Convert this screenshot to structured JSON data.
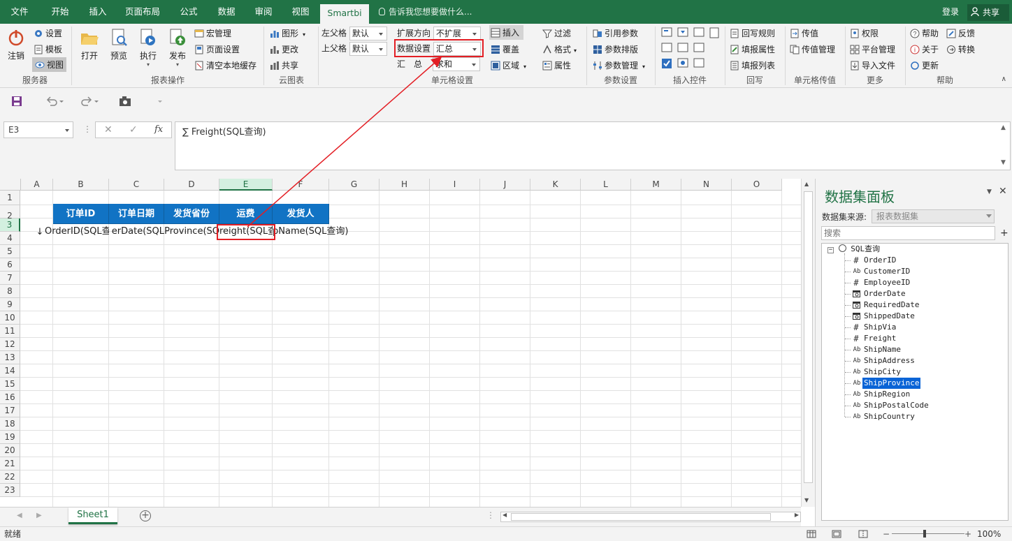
{
  "tabs": [
    "文件",
    "开始",
    "插入",
    "页面布局",
    "公式",
    "数据",
    "审阅",
    "视图",
    "Smartbi"
  ],
  "tell_me": "告诉我您想要做什么...",
  "login": "登录",
  "share": "共享",
  "ribbon": {
    "server": {
      "label": "服务器",
      "logout": "注销",
      "settings": "设置",
      "template": "模板",
      "view": "视图"
    },
    "report_ops": {
      "label": "报表操作",
      "open": "打开",
      "preview": "预览",
      "execute": "执行",
      "publish": "发布",
      "macro": "宏管理",
      "page_setup": "页面设置",
      "clear_cache": "清空本地缓存"
    },
    "cloud_chart": {
      "label": "云图表",
      "chart": "图形",
      "change": "更改",
      "share": "共享"
    },
    "cell_settings": {
      "label": "单元格设置",
      "left_parent": "左父格",
      "top_parent": "上父格",
      "left_parent_value": "默认",
      "top_parent_value": "默认",
      "expand_dir": "扩展方向",
      "expand_value": "不扩展",
      "data_setting": "数据设置",
      "data_value": "汇总",
      "summary": "汇　总",
      "summary_value": "求和",
      "insert": "插入",
      "cover": "覆盖",
      "region": "区域",
      "filter": "过滤",
      "format": "格式",
      "property": "属性"
    },
    "param_settings": {
      "label": "参数设置",
      "ref_param": "引用参数",
      "param_layout": "参数排版",
      "param_manage": "参数管理"
    },
    "insert_controls": {
      "label": "插入控件"
    },
    "writeback": {
      "label": "回写",
      "rules": "回写规则",
      "fill_props": "填报属性",
      "fill_list": "填报列表"
    },
    "cell_pass": {
      "label": "单元格传值",
      "pass": "传值",
      "pass_manage": "传值管理"
    },
    "more": {
      "label": "更多",
      "permission": "权限",
      "platform": "平台管理",
      "import": "导入文件"
    },
    "help": {
      "label": "帮助",
      "help": "帮助",
      "feedback": "反馈",
      "about": "关于",
      "convert": "转换",
      "update": "更新"
    }
  },
  "formula_bar": {
    "cell_ref": "E3",
    "formula": "∑ Freight(SQL查询)"
  },
  "columns": [
    "A",
    "B",
    "C",
    "D",
    "E",
    "F",
    "G",
    "H",
    "I",
    "J",
    "K",
    "L",
    "M",
    "N",
    "O"
  ],
  "rows": [
    "1",
    "2",
    "3",
    "4",
    "5",
    "6",
    "7",
    "8",
    "9",
    "10",
    "11",
    "12",
    "13",
    "14",
    "15",
    "16",
    "17",
    "18",
    "19",
    "20",
    "21",
    "22",
    "23"
  ],
  "header_cells": [
    "订单ID",
    "订单日期",
    "发货省份",
    "运费",
    "发货人"
  ],
  "data_cells": [
    "OrderID(SQL查",
    "erDate(SQL",
    "Province(SQ",
    "reight(SQL查",
    "pName(SQL查询)"
  ],
  "data_cell_prefix": "↓",
  "sheet_tab": "Sheet1",
  "status_text": "就绪",
  "zoom": "100%",
  "panel": {
    "title": "数据集面板",
    "source_label": "数据集来源:",
    "source_value": "报表数据集",
    "search_placeholder": "搜索",
    "root": "SQL查询",
    "fields": [
      {
        "name": "OrderID",
        "type": "#"
      },
      {
        "name": "CustomerID",
        "type": "Ab"
      },
      {
        "name": "EmployeeID",
        "type": "#"
      },
      {
        "name": "OrderDate",
        "type": "date"
      },
      {
        "name": "RequiredDate",
        "type": "date"
      },
      {
        "name": "ShippedDate",
        "type": "date"
      },
      {
        "name": "ShipVia",
        "type": "#"
      },
      {
        "name": "Freight",
        "type": "#"
      },
      {
        "name": "ShipName",
        "type": "Ab"
      },
      {
        "name": "ShipAddress",
        "type": "Ab"
      },
      {
        "name": "ShipCity",
        "type": "Ab"
      },
      {
        "name": "ShipProvince",
        "type": "Ab",
        "selected": true
      },
      {
        "name": "ShipRegion",
        "type": "Ab"
      },
      {
        "name": "ShipPostalCode",
        "type": "Ab"
      },
      {
        "name": "ShipCountry",
        "type": "Ab"
      }
    ]
  },
  "colors": {
    "brand": "#217346",
    "header_fill": "#1173c4",
    "highlight": "#e31e24",
    "selected": "#0a64d6"
  }
}
